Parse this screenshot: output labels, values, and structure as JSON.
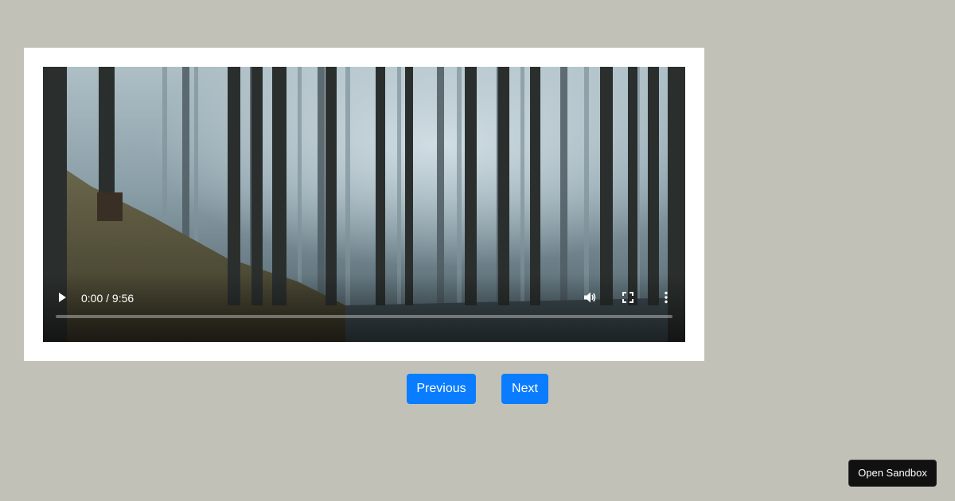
{
  "video": {
    "current_time": "0:00",
    "duration": "9:56",
    "progress_fraction": 0,
    "poster_description_icon": "misty-forest-image"
  },
  "controls": {
    "play_icon": "play-icon",
    "volume_icon": "volume-icon",
    "fullscreen_icon": "fullscreen-icon",
    "more_icon": "more-vertical-icon"
  },
  "navigation": {
    "previous_label": "Previous",
    "next_label": "Next"
  },
  "sandbox": {
    "label": "Open Sandbox"
  },
  "colors": {
    "background": "#c1c1b8",
    "card": "#ffffff",
    "accent": "#0a7cff",
    "sandbox_button": "#111111"
  }
}
